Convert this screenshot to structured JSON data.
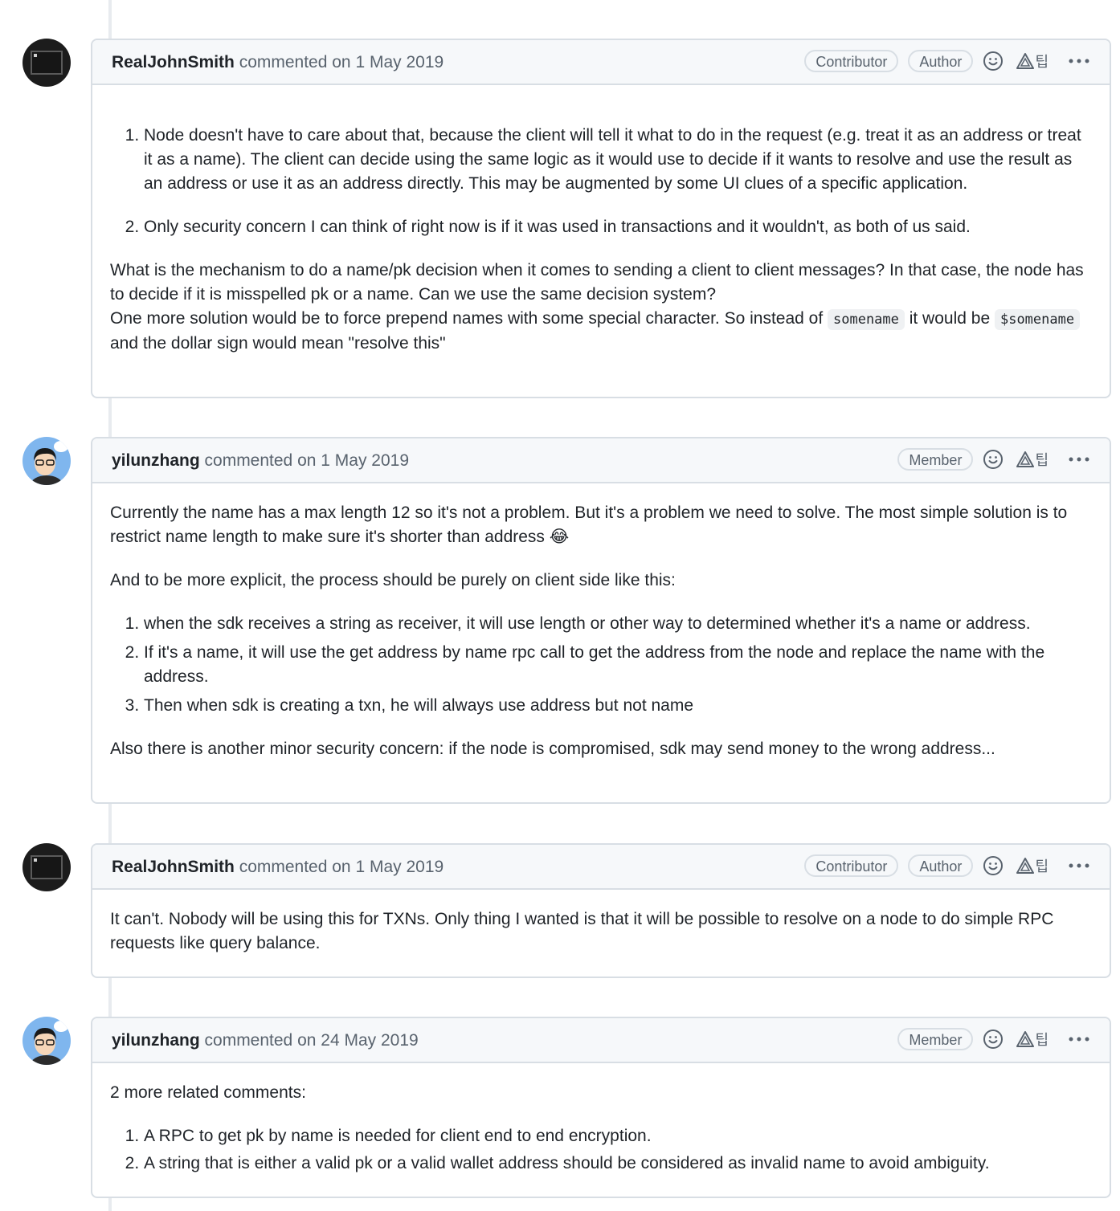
{
  "comments": [
    {
      "author": "RealJohnSmith",
      "meta": "commented on 1 May 2019",
      "badges": [
        "Contributor",
        "Author"
      ],
      "avatar": "terminal-avatar",
      "list1": [
        "Node doesn't have to care about that, because the client will tell it what to do in the request (e.g. treat it as an address or treat it as a name). The client can decide using the same logic as it would use to decide if it wants to resolve and use the result as an address or use it as an address directly. This may be augmented by some UI clues of a specific application.",
        "Only security concern I can think of right now is if it was used in transactions and it wouldn't, as both of us said."
      ],
      "para1_line1": "What is the mechanism to do a name/pk decision when it comes to sending a client to client messages? In that case, the node has to decide if it is misspelled pk or a name. Can we use the same decision system?",
      "para1_line2_a": "One more solution would be to force prepend names with some special character. So instead of ",
      "code1": "somename",
      "para1_line2_b": " it would be ",
      "code2": "$somename",
      "para1_line2_c": " and the dollar sign would mean \"resolve this\""
    },
    {
      "author": "yilunzhang",
      "meta": "commented on 1 May 2019",
      "badges": [
        "Member"
      ],
      "avatar": "cartoon-avatar",
      "para1": "Currently the name has a max length 12 so it's not a problem. But it's a problem we need to solve. The most simple solution is to restrict name length to make sure it's shorter than address",
      "emoji": "😂",
      "para2": "And to be more explicit, the process should be purely on client side like this:",
      "list1": [
        "when the sdk receives a string as receiver, it will use length or other way to determined whether it's a name or address.",
        "If it's a name, it will use the get address by name rpc call to get the address from the node and replace the name with the address.",
        "Then when sdk is creating a txn, he will always use address but not name"
      ],
      "para3": "Also there is another minor security concern: if the node is compromised, sdk may send money to the wrong address..."
    },
    {
      "author": "RealJohnSmith",
      "meta": "commented on 1 May 2019",
      "badges": [
        "Contributor",
        "Author"
      ],
      "avatar": "terminal-avatar",
      "para1": "It can't. Nobody will be using this for TXNs. Only thing I wanted is that it will be possible to resolve on a node to do simple RPC requests like query balance."
    },
    {
      "author": "yilunzhang",
      "meta": "commented on 24 May 2019",
      "badges": [
        "Member"
      ],
      "avatar": "cartoon-avatar",
      "para1": "2 more related comments:",
      "list1": [
        "A RPC to get pk by name is needed for client end to end encryption.",
        "A string that is either a valid pk or a valid wallet address should be considered as invalid name to avoid ambiguity."
      ]
    }
  ],
  "icons": {
    "reaction": "smiley-icon",
    "translate": "translate-icon",
    "translate_glyph": "팁",
    "more": "kebab-horizontal-icon"
  }
}
